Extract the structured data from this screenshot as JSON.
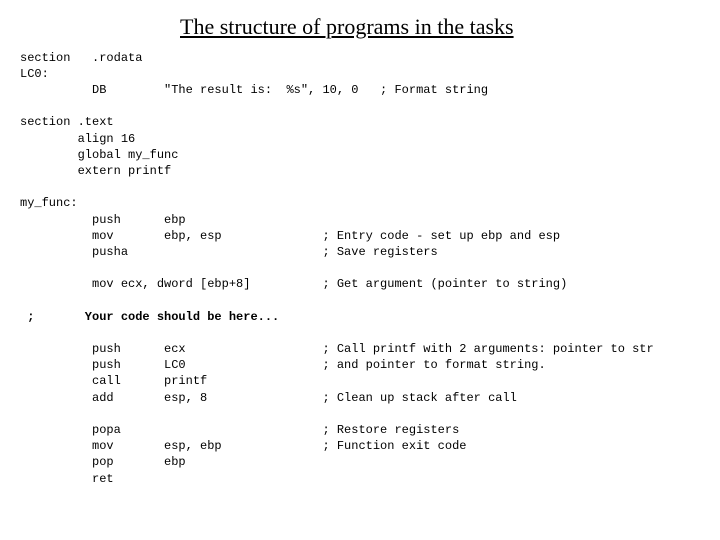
{
  "title": "The structure of programs in the tasks",
  "lines": {
    "l0": "section   .rodata",
    "l1": "LC0:",
    "l2": "          DB        \"The result is:  %s\", 10, 0   ; Format string",
    "l3": "",
    "l4": "section .text",
    "l5": "        align 16",
    "l6": "        global my_func",
    "l7": "        extern printf",
    "l8": "",
    "l9": "my_func:",
    "l10": "          push      ebp                   ",
    "l11": "          mov       ebp, esp              ; Entry code - set up ebp and esp",
    "l12": "          pusha                           ; Save registers",
    "l13": "",
    "l14": "          mov ecx, dword [ebp+8]          ; Get argument (pointer to string)",
    "l15": "",
    "l16": " ;       Your code should be here...",
    "l17": "",
    "l18": "          push      ecx                   ; Call printf with 2 arguments: pointer to str",
    "l19": "          push      LC0                   ; and pointer to format string.",
    "l20": "          call      printf",
    "l21": "          add       esp, 8                ; Clean up stack after call",
    "l22": "",
    "l23": "          popa                            ; Restore registers",
    "l24": "          mov       esp, ebp              ; Function exit code",
    "l25": "          pop       ebp",
    "l26": "          ret"
  }
}
